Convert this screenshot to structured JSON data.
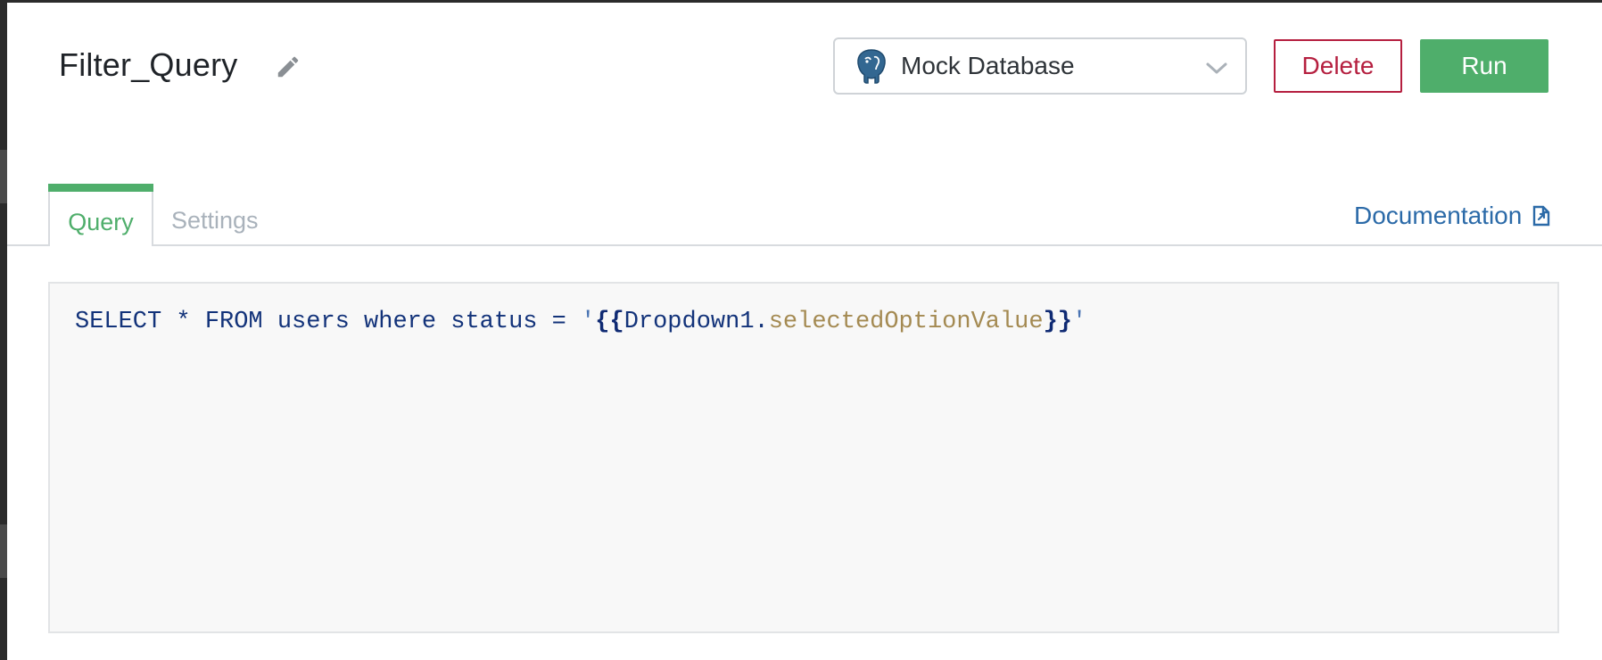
{
  "query": {
    "name": "Filter_Query"
  },
  "datasource": {
    "selected": "Mock Database",
    "icon": "postgres-elephant-icon"
  },
  "actions": {
    "delete_label": "Delete",
    "run_label": "Run"
  },
  "tabs": [
    {
      "label": "Query",
      "active": true
    },
    {
      "label": "Settings",
      "active": false
    }
  ],
  "documentation": {
    "label": "Documentation",
    "icon": "external-link-icon"
  },
  "editor": {
    "tokens": {
      "sql": "SELECT * FROM users where status = ",
      "quote_open": "'",
      "brace_open": "{{",
      "object": "Dropdown1.",
      "property": "selectedOptionValue",
      "brace_close": "}}",
      "quote_close": "'"
    }
  },
  "colors": {
    "accent_green": "#4fae6b",
    "danger_red": "#b51f3f",
    "link_blue": "#2b6aa8",
    "code_blue": "#13337a",
    "code_property": "#a48a52"
  }
}
